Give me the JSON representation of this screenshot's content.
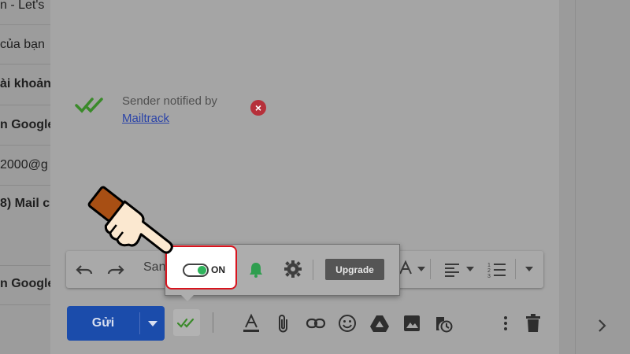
{
  "inbox": {
    "lines": [
      {
        "text": "n - Let's",
        "bold": false,
        "bold_part": "n"
      },
      {
        "text": "của bạn",
        "bold": false
      },
      {
        "text": "ài khoản",
        "bold": true
      },
      {
        "text": "n Google",
        "bold": true
      },
      {
        "text": "2000@g",
        "bold": false
      },
      {
        "text": "8) Mail c",
        "bold": true
      },
      {
        "text": "n Google",
        "bold": true
      }
    ]
  },
  "mailtrack": {
    "notified_text": "Sender notified by",
    "link_text": "Mailtrack",
    "close_icon": "close-icon"
  },
  "format_bar": {
    "font_label": "Sans"
  },
  "popup": {
    "toggle_label": "ON",
    "toggle_on": true,
    "upgrade_label": "Upgrade"
  },
  "bottom_bar": {
    "send_label": "Gửi"
  },
  "colors": {
    "send_blue": "#1b4cab",
    "toggle_green": "#2fb35c",
    "highlight_red": "#d8141e",
    "check_green": "#3a8a2a"
  }
}
